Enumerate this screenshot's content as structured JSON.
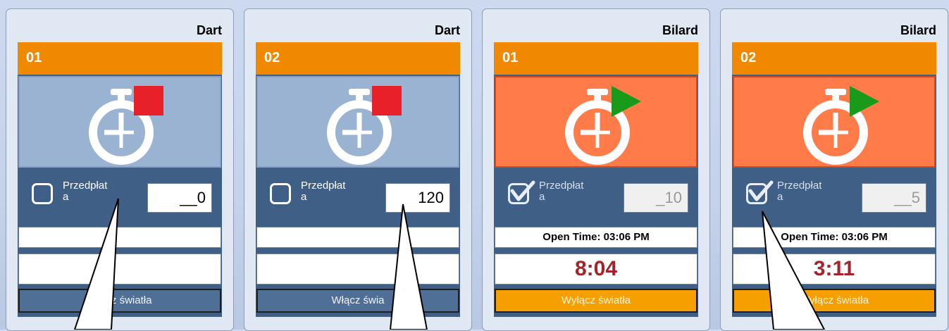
{
  "colors": {
    "number_bar": "#f08900",
    "card_body": "#3f5f86",
    "tile_idle": "#9bb3d2",
    "tile_running": "#ff7b4a",
    "stop_indicator": "#e8202a",
    "play_indicator": "#1a9a1a",
    "timer_text": "#a3242a",
    "light_button_off": "#4f6f97",
    "light_button_on": "#f5a000"
  },
  "panels": [
    {
      "game": "Dart",
      "number": "01",
      "status_icon": "stopwatch-stop-icon",
      "prepaid_checked": false,
      "prepaid_label": "Przedpłat\na",
      "prepaid_amount": "__0",
      "open_time": "",
      "timer": "",
      "light_button": "Włącz światła"
    },
    {
      "game": "Dart",
      "number": "02",
      "status_icon": "stopwatch-stop-icon",
      "prepaid_checked": false,
      "prepaid_label": "Przedpłat\na",
      "prepaid_amount": "120",
      "open_time": "",
      "timer": "",
      "light_button": "Włącz świa"
    },
    {
      "game": "Bilard",
      "number": "01",
      "status_icon": "stopwatch-play-icon",
      "prepaid_checked": true,
      "prepaid_label": "Przedpłat\na",
      "prepaid_amount": "_10",
      "open_time": "Open Time: 03:06 PM",
      "timer": "8:04",
      "light_button": "Wyłącz światła"
    },
    {
      "game": "Bilard",
      "number": "02",
      "status_icon": "stopwatch-play-icon",
      "prepaid_checked": true,
      "prepaid_label": "Przedpłat\na",
      "prepaid_amount": "__5",
      "open_time": "Open Time: 03:06 PM",
      "timer": "3:11",
      "light_button": "Wyłącz światła"
    }
  ]
}
